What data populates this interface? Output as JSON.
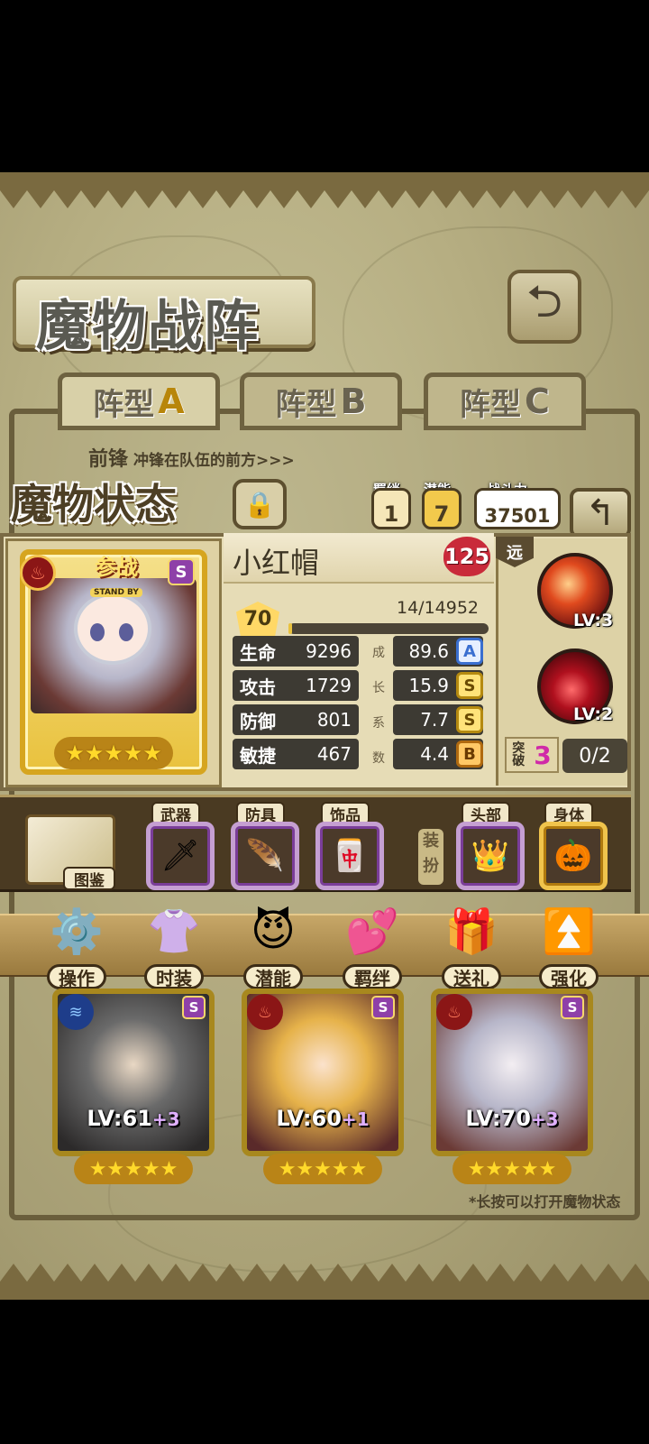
{
  "page": {
    "title": "魔物战阵"
  },
  "tabs": [
    {
      "label": "阵型",
      "letter": "A",
      "active": true
    },
    {
      "label": "阵型",
      "letter": "B",
      "active": false
    },
    {
      "label": "阵型",
      "letter": "C",
      "active": false
    }
  ],
  "formation": {
    "row_label": "前锋",
    "row_hint": "冲锋在队伍的前方>>>"
  },
  "status": {
    "title": "魔物状态",
    "bond": {
      "label": "羁绊",
      "value": "1"
    },
    "potential": {
      "label": "潜能",
      "value": "7"
    },
    "power": {
      "label": "战斗力",
      "value": "37501"
    }
  },
  "character": {
    "name": "小红帽",
    "rank": "125",
    "level": "70",
    "exp_text": "14/14952",
    "exp_fraction": 0.001,
    "standby_cn": "参战",
    "standby_en": "STAND BY",
    "grade": "S",
    "stars": "★★★★★",
    "stats": [
      {
        "key": "生命",
        "value": "9296",
        "growth": "89.6",
        "grade": "A"
      },
      {
        "key": "攻击",
        "value": "1729",
        "growth": "15.9",
        "grade": "S"
      },
      {
        "key": "防御",
        "value": "801",
        "growth": "7.7",
        "grade": "S"
      },
      {
        "key": "敏捷",
        "value": "467",
        "growth": "4.4",
        "grade": "B"
      }
    ],
    "growth_label": [
      "成",
      "长",
      "系",
      "数"
    ]
  },
  "skills": {
    "range_label": "远",
    "items": [
      {
        "level": "LV:3"
      },
      {
        "level": "LV:2"
      }
    ]
  },
  "breakthrough": {
    "label": "突破",
    "value": "3",
    "progress": "0/2"
  },
  "equipment": {
    "atlas_label": "图鉴",
    "slots": [
      {
        "label": "武器",
        "icon": "weapon-icon"
      },
      {
        "label": "防具",
        "icon": "armor-icon"
      },
      {
        "label": "饰品",
        "icon": "accessory-icon"
      },
      {
        "label": "头部",
        "icon": "crown-icon"
      },
      {
        "label": "身体",
        "icon": "pumpkin-icon"
      }
    ],
    "equip_label": "装扮"
  },
  "actions": [
    {
      "label": "操作",
      "icon": "gear-icon"
    },
    {
      "label": "时装",
      "icon": "outfit-icon"
    },
    {
      "label": "潜能",
      "icon": "demon-icon"
    },
    {
      "label": "羁绊",
      "icon": "hearts-icon"
    },
    {
      "label": "送礼",
      "icon": "gift-icon"
    },
    {
      "label": "强化",
      "icon": "upgrade-arrows-icon"
    }
  ],
  "team": [
    {
      "level": "LV:61",
      "plus": "+3",
      "grade": "S",
      "stars": "★★★★★"
    },
    {
      "level": "LV:60",
      "plus": "+1",
      "grade": "S",
      "stars": "★★★★★"
    },
    {
      "level": "LV:70",
      "plus": "+3",
      "grade": "S",
      "stars": "★★★★★"
    }
  ],
  "tip": "*长按可以打开魔物状态",
  "colors": {
    "gold": "#e9c23e",
    "purple_grade": "#8e40a8",
    "panel": "#e6dcb6"
  }
}
